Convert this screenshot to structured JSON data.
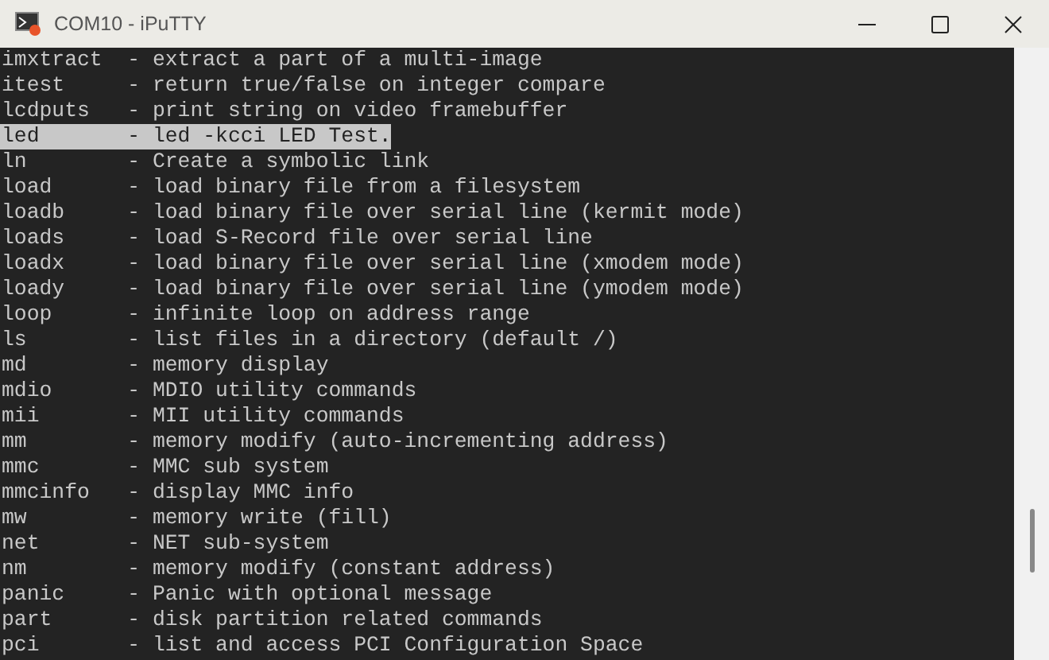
{
  "window": {
    "title": "COM10 - iPuTTY"
  },
  "terminal": {
    "lines": [
      {
        "text": "imxtract  - extract a part of a multi-image",
        "selected": false
      },
      {
        "text": "itest     - return true/false on integer compare",
        "selected": false
      },
      {
        "text": "lcdputs   - print string on video framebuffer",
        "selected": false
      },
      {
        "text": "led       - led -kcci LED Test.",
        "selected": true
      },
      {
        "text": "ln        - Create a symbolic link",
        "selected": false
      },
      {
        "text": "load      - load binary file from a filesystem",
        "selected": false
      },
      {
        "text": "loadb     - load binary file over serial line (kermit mode)",
        "selected": false
      },
      {
        "text": "loads     - load S-Record file over serial line",
        "selected": false
      },
      {
        "text": "loadx     - load binary file over serial line (xmodem mode)",
        "selected": false
      },
      {
        "text": "loady     - load binary file over serial line (ymodem mode)",
        "selected": false
      },
      {
        "text": "loop      - infinite loop on address range",
        "selected": false
      },
      {
        "text": "ls        - list files in a directory (default /)",
        "selected": false
      },
      {
        "text": "md        - memory display",
        "selected": false
      },
      {
        "text": "mdio      - MDIO utility commands",
        "selected": false
      },
      {
        "text": "mii       - MII utility commands",
        "selected": false
      },
      {
        "text": "mm        - memory modify (auto-incrementing address)",
        "selected": false
      },
      {
        "text": "mmc       - MMC sub system",
        "selected": false
      },
      {
        "text": "mmcinfo   - display MMC info",
        "selected": false
      },
      {
        "text": "mw        - memory write (fill)",
        "selected": false
      },
      {
        "text": "net       - NET sub-system",
        "selected": false
      },
      {
        "text": "nm        - memory modify (constant address)",
        "selected": false
      },
      {
        "text": "panic     - Panic with optional message",
        "selected": false
      },
      {
        "text": "part      - disk partition related commands",
        "selected": false
      },
      {
        "text": "pci       - list and access PCI Configuration Space",
        "selected": false
      }
    ]
  }
}
